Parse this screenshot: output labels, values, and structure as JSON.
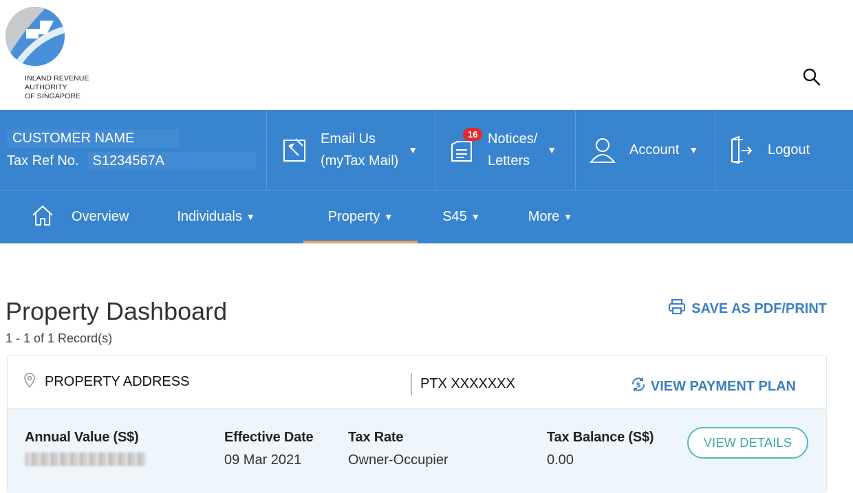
{
  "org": {
    "line1": "INLAND REVENUE",
    "line2": "AUTHORITY",
    "line3": "OF SINGAPORE"
  },
  "user": {
    "name": "CUSTOMER NAME",
    "tax_ref_label": "Tax Ref No.",
    "tax_ref_value": "S1234567A"
  },
  "menu": {
    "email_line1": "Email Us",
    "email_line2": "(myTax Mail)",
    "notices_line1": "Notices/",
    "notices_line2": "Letters",
    "notices_count": "16",
    "account": "Account",
    "logout": "Logout"
  },
  "nav": {
    "overview": "Overview",
    "individuals": "Individuals",
    "property": "Property",
    "s45": "S45",
    "more": "More"
  },
  "page": {
    "title": "Property Dashboard",
    "record_count": "1 - 1 of 1 Record(s)",
    "save_pdf": "SAVE AS PDF/PRINT"
  },
  "property": {
    "address": "PROPERTY ADDRESS",
    "ptx": "PTX XXXXXXX",
    "payment_plan": "VIEW PAYMENT PLAN",
    "annual_value_label": "Annual Value (S$)",
    "effective_date_label": "Effective Date",
    "effective_date": "09 Mar 2021",
    "tax_rate_label": "Tax Rate",
    "tax_rate": "Owner-Occupier",
    "tax_balance_label": "Tax Balance (S$)",
    "tax_balance": "0.00",
    "view_details": "VIEW DETAILS"
  },
  "colors": {
    "brand_blue": "#3884cf",
    "accent_underline": "#e8a06a",
    "link_blue": "#3a7fc4",
    "teal": "#4fbdb7",
    "badge_red": "#e12b2b"
  },
  "icons": [
    "logo-icon",
    "search-icon",
    "email-icon",
    "notices-icon",
    "account-icon",
    "logout-icon",
    "home-icon",
    "printer-icon",
    "location-pin-icon",
    "payment-plan-icon"
  ]
}
